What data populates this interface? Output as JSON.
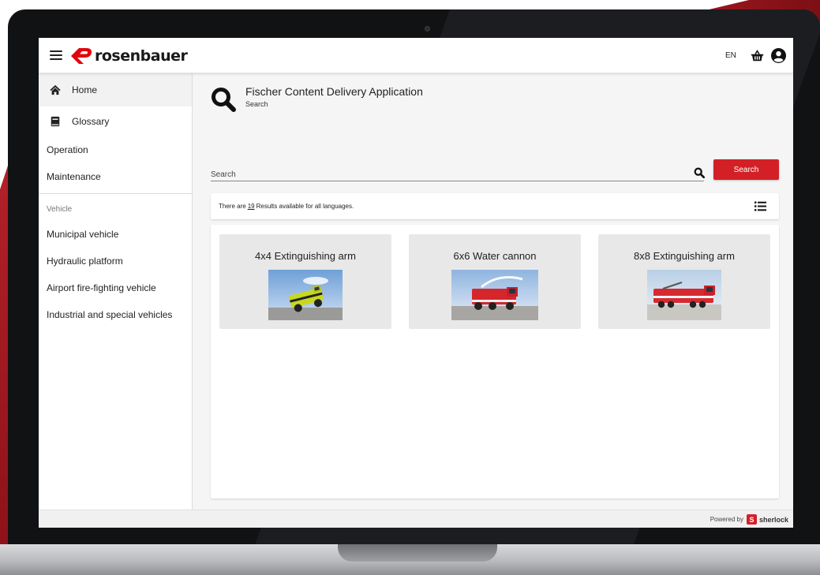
{
  "topbar": {
    "brand": "rosenbauer",
    "language": "EN",
    "icons": {
      "menu": "hamburger-menu-icon",
      "basket": "basket-icon",
      "user": "user-account-icon"
    }
  },
  "sidebar": {
    "items": [
      {
        "label": "Home",
        "icon": "home-icon"
      },
      {
        "label": "Glossary",
        "icon": "book-icon"
      },
      {
        "label": "Operation"
      },
      {
        "label": "Maintenance"
      }
    ],
    "section_label": "Vehicle",
    "vehicle_items": [
      {
        "label": "Municipal vehicle"
      },
      {
        "label": "Hydraulic platform"
      },
      {
        "label": "Airport fire-fighting vehicle"
      },
      {
        "label": "Industrial and special vehicles"
      }
    ]
  },
  "main": {
    "title": "Fischer Content Delivery Application",
    "subtitle": "Search",
    "search": {
      "placeholder": "Search",
      "button_label": "Search"
    },
    "results": {
      "prefix": "There are",
      "count": "19",
      "suffix": "Results available for all languages."
    },
    "cards": [
      {
        "title": "4x4 Extinguishing arm",
        "image": "yellow-green airport fire truck"
      },
      {
        "title": "6x6 Water cannon",
        "image": "red fire truck spraying water"
      },
      {
        "title": "8x8 Extinguishing arm",
        "image": "red 8x8 fire truck"
      }
    ]
  },
  "footer": {
    "powered_by": "Powered by",
    "brand": "sherlock"
  },
  "colors": {
    "accent": "#d32027",
    "brand_red": "#e3000f",
    "background": "#f5f5f5"
  }
}
